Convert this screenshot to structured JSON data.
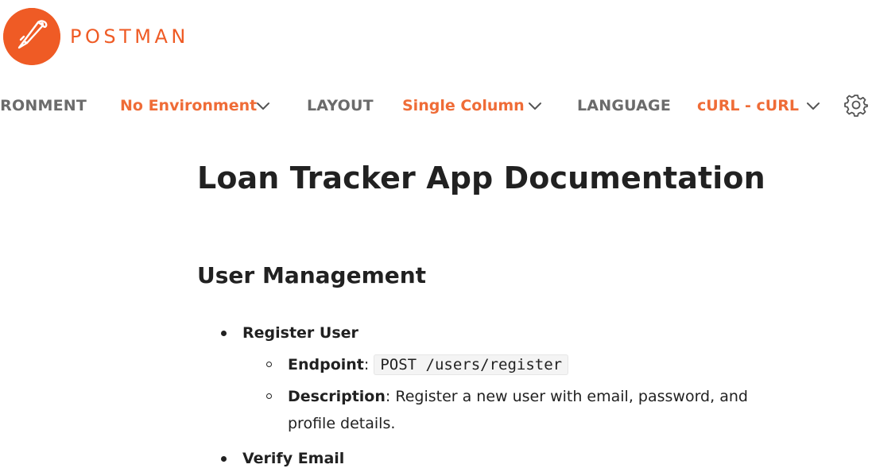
{
  "brand": {
    "name": "POSTMAN",
    "color": "#ef5b25",
    "icon": "postman-rocket-logo"
  },
  "topbar": {
    "environment_label": "VIRONMENT",
    "environment_value": "No Environment",
    "layout_label": "LAYOUT",
    "layout_value": "Single Column",
    "language_label": "LANGUAGE",
    "language_value": "cURL - cURL",
    "settings_icon": "gear-icon",
    "accent_color": "#ef6c37"
  },
  "doc": {
    "title": "Loan Tracker App Documentation",
    "section": "User Management",
    "items": [
      {
        "title": "Register User",
        "endpoint_label": "Endpoint",
        "endpoint": "POST /users/register",
        "description_label": "Description",
        "description": "Register a new user with email, password, and profile details."
      },
      {
        "title": "Verify Email"
      }
    ]
  }
}
